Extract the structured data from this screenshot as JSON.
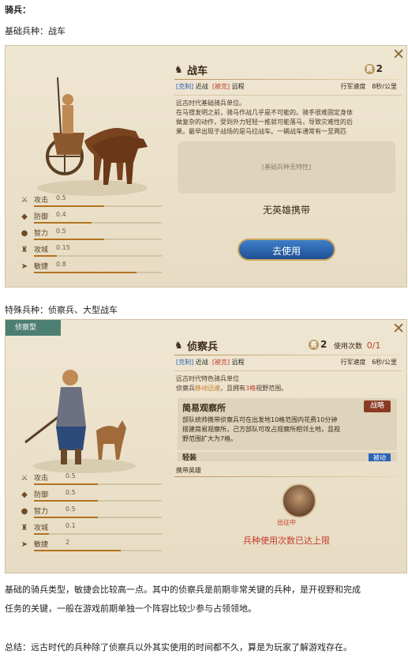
{
  "header": {
    "cavalry_heading": "骑兵：",
    "basic_label": "基础兵种：战车",
    "special_label": "特殊兵种：侦察兵、大型战车",
    "paragraph1": "基础的骑兵类型，敏捷会比较高一点。其中的侦察兵是前期非常关键的兵种，是开视野和完成",
    "paragraph2": "任务的关键，一般在游戏前期单独一个阵容比较少参与占领领地。",
    "summary": "总结：远古时代的兵种除了侦察兵以外其实使用的时间都不久，算是为玩家了解游戏存在。"
  },
  "card1": {
    "name": "战车",
    "cost": "2",
    "counter_tag": "[克制]",
    "counter_value": "近战",
    "countered_tag": "[被克]",
    "countered_value": "远程",
    "speed_label": "行军速度",
    "speed_value": "8秒/公里",
    "desc": [
      "远古时代基础骑兵单位。",
      "在马镫发明之前，骑马作战几乎是不可能的。骑手很难固定身体",
      "做复杂的动作，受到外力轻轻一推就可能落马，导致灾难性的后",
      "果。最早出现于战场的是马拉战车。一辆战车通常有一至两匹"
    ],
    "trait_box": "[基础兵种无特性]",
    "no_hero": "无英雄携带",
    "use_button": "去使用",
    "stats": [
      {
        "label": "攻击",
        "value": "0.5",
        "fill": 0.55
      },
      {
        "label": "防御",
        "value": "0.4",
        "fill": 0.45
      },
      {
        "label": "智力",
        "value": "0.5",
        "fill": 0.55
      },
      {
        "label": "攻城",
        "value": "0.15",
        "fill": 0.18
      },
      {
        "label": "敏捷",
        "value": "0.8",
        "fill": 0.8
      }
    ]
  },
  "card2": {
    "badge": "侦察型",
    "name": "侦察兵",
    "cost": "2",
    "uses_label": "使用次数",
    "uses_value": "0/1",
    "counter_tag": "[克制]",
    "counter_value": "近战",
    "countered_tag": "[被克]",
    "countered_value": "远程",
    "speed_label": "行军速度",
    "speed_value": "6秒/公里",
    "desc_line1": "远古时代特色骑兵单位",
    "desc_line2_a": "侦察兵",
    "desc_line2_b": "移动迅速",
    "desc_line2_c": "，且拥有",
    "desc_line2_d": "3格",
    "desc_line2_e": "视野范围。",
    "skill_name": "简易观察所",
    "skill_badge": "战略",
    "skill_text": [
      "部队统帅携带侦察兵可在出发地10格范围内花费10分钟",
      "搭建简易观察所，己方部队可攻占观察所相邻土地，且视",
      "野范围扩大为7格。"
    ],
    "skill2_name": "轻装",
    "skill2_badge": "被动",
    "carry_hero_label": "携带英雄",
    "hero_status": "出征中",
    "limit_text": "兵种使用次数已达上限",
    "stats": [
      {
        "label": "攻击",
        "value": "0.5",
        "fill": 0.5
      },
      {
        "label": "防御",
        "value": "0.5",
        "fill": 0.5
      },
      {
        "label": "智力",
        "value": "0.5",
        "fill": 0.5
      },
      {
        "label": "攻城",
        "value": "0.1",
        "fill": 0.12
      },
      {
        "label": "敏捷",
        "value": "2",
        "fill": 0.68
      }
    ]
  }
}
